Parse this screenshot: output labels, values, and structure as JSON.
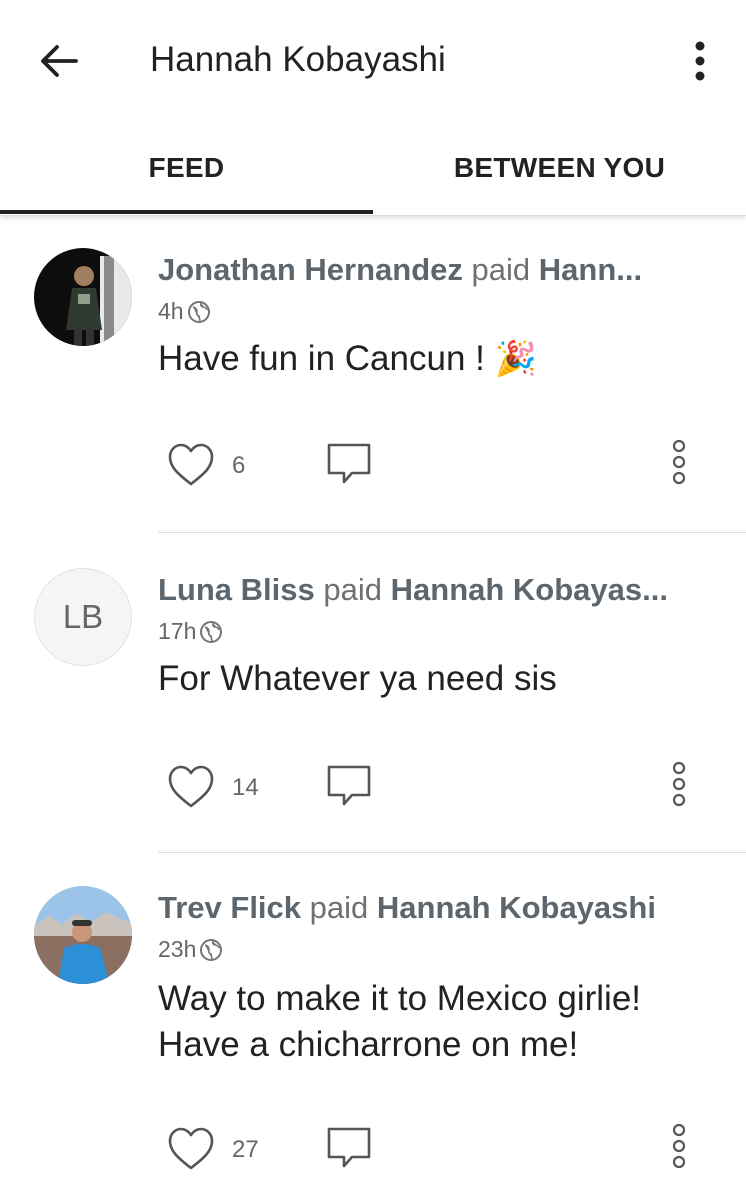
{
  "header": {
    "title": "Hannah Kobayashi",
    "back_icon": "arrow-left-icon",
    "menu_icon": "more-vertical-icon"
  },
  "tabs": [
    {
      "label": "FEED",
      "active": true
    },
    {
      "label": "BETWEEN YOU",
      "active": false
    }
  ],
  "feed": [
    {
      "actor": "Jonathan Hernandez",
      "verb": "paid",
      "target": "Hann...",
      "time": "4h",
      "privacy_icon": "globe-icon",
      "note": "Have fun in Cancun ! ",
      "emoji": "🎉",
      "likes": "6",
      "avatar": "photo"
    },
    {
      "actor": "Luna Bliss",
      "verb": "paid",
      "target": "Hannah Kobayas...",
      "time": "17h",
      "privacy_icon": "globe-icon",
      "note": "For Whatever ya need sis",
      "likes": "14",
      "avatar_initials": "LB"
    },
    {
      "actor": "Trev Flick",
      "verb": "paid",
      "target": "Hannah Kobayashi",
      "time": "23h",
      "privacy_icon": "globe-icon",
      "note": "Way to make it to Mexico girlie! Have a chicharrone on me!",
      "likes": "27",
      "avatar": "photo"
    }
  ],
  "colors": {
    "text": "#222222",
    "muted": "#707070",
    "actor": "#5e666d",
    "divider": "#dddddd"
  }
}
